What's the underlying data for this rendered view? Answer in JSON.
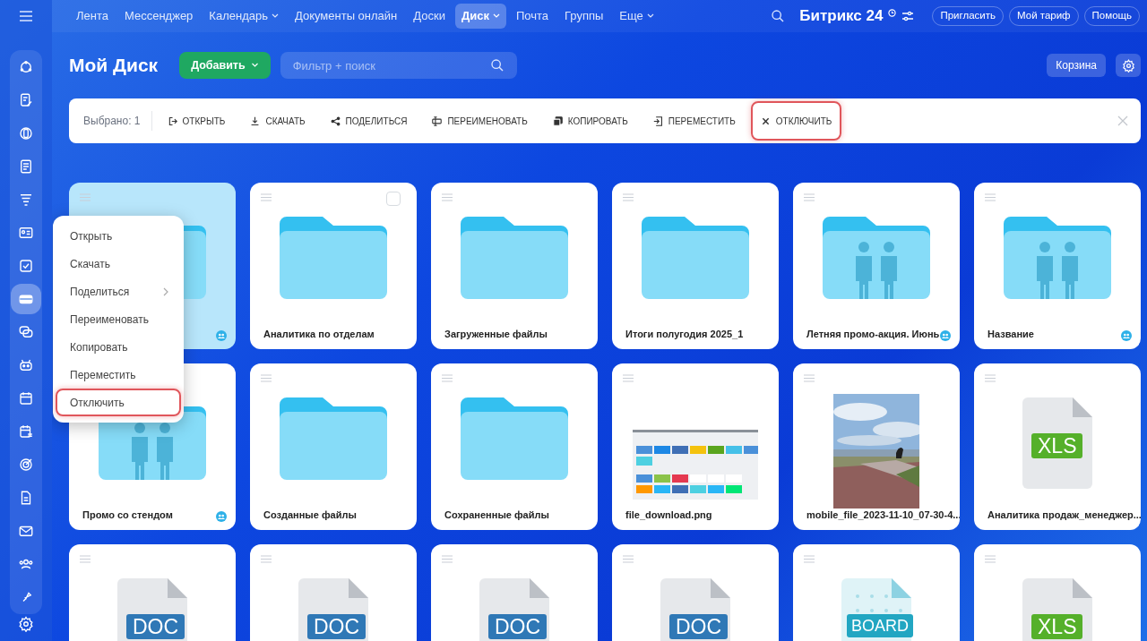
{
  "topbar": {
    "nav": [
      {
        "label": "Лента",
        "selected": false,
        "dropdown": false
      },
      {
        "label": "Мессенджер",
        "selected": false,
        "dropdown": false
      },
      {
        "label": "Календарь",
        "selected": false,
        "dropdown": true
      },
      {
        "label": "Документы онлайн",
        "selected": false,
        "dropdown": false
      },
      {
        "label": "Доски",
        "selected": false,
        "dropdown": false
      },
      {
        "label": "Диск",
        "selected": true,
        "dropdown": true
      },
      {
        "label": "Почта",
        "selected": false,
        "dropdown": false
      },
      {
        "label": "Группы",
        "selected": false,
        "dropdown": false
      },
      {
        "label": "Еще",
        "selected": false,
        "dropdown": true
      }
    ],
    "logo": "Битрикс 24",
    "buttons": [
      "Пригласить",
      "Мой тариф",
      "Помощь"
    ]
  },
  "sidebar": {
    "items": [
      {
        "kind": "recycle",
        "selected": false
      },
      {
        "kind": "edit",
        "selected": false
      },
      {
        "kind": "crm",
        "selected": false
      },
      {
        "kind": "document",
        "selected": false
      },
      {
        "kind": "funnel",
        "selected": false
      },
      {
        "kind": "card",
        "selected": false
      },
      {
        "kind": "tasks",
        "selected": false
      },
      {
        "kind": "drive",
        "selected": true
      },
      {
        "kind": "chat",
        "selected": false
      },
      {
        "kind": "robot",
        "selected": false
      },
      {
        "kind": "calendar",
        "selected": false
      },
      {
        "kind": "schedule",
        "selected": false
      },
      {
        "kind": "target",
        "selected": false
      },
      {
        "kind": "file",
        "selected": false
      },
      {
        "kind": "mail",
        "selected": false
      },
      {
        "kind": "people",
        "selected": false
      },
      {
        "kind": "pin",
        "selected": false
      }
    ]
  },
  "header": {
    "title": "Мой Диск",
    "add_button": "Добавить",
    "search": {
      "placeholder": "Фильтр + поиск"
    },
    "trash_button": "Корзина"
  },
  "action_bar": {
    "selected_count": "Выбрано: 1",
    "actions": [
      {
        "kind": "open",
        "label": "ОТКРЫТЬ",
        "highlighted": false
      },
      {
        "kind": "download",
        "label": "СКАЧАТЬ",
        "highlighted": false
      },
      {
        "kind": "share",
        "label": "ПОДЕЛИТЬСЯ",
        "highlighted": false
      },
      {
        "kind": "rename",
        "label": "ПЕРЕИМЕНОВАТЬ",
        "highlighted": false
      },
      {
        "kind": "copy",
        "label": "КОПИРОВАТЬ",
        "highlighted": false
      },
      {
        "kind": "move",
        "label": "ПЕРЕМЕСТИТЬ",
        "highlighted": false
      },
      {
        "kind": "disconnect",
        "label": "ОТКЛЮЧИТЬ",
        "highlighted": true
      }
    ]
  },
  "files": [
    {
      "kind": "folder",
      "selected": true,
      "shared": true,
      "hovered": false
    },
    {
      "kind": "folder",
      "name": "Аналитика по отделам",
      "selected": false,
      "shared": false,
      "hovered": true
    },
    {
      "kind": "folder",
      "name": "Загруженные файлы",
      "selected": false,
      "shared": false,
      "hovered": false
    },
    {
      "kind": "folder",
      "name": "Итоги полугодия 2025_1",
      "selected": false,
      "shared": false,
      "hovered": false
    },
    {
      "kind": "shared_folder",
      "name": "Летняя промо-акция. Июнь",
      "selected": false,
      "shared": true,
      "hovered": false
    },
    {
      "kind": "shared_folder",
      "name": "Название",
      "selected": false,
      "shared": true,
      "hovered": false
    },
    {
      "kind": "shared_folder",
      "name": "Промо со стендом",
      "selected": false,
      "shared": true,
      "hovered": false
    },
    {
      "kind": "folder",
      "name": "Созданные файлы",
      "selected": false,
      "shared": false,
      "hovered": false
    },
    {
      "kind": "folder",
      "name": "Сохраненные файлы",
      "selected": false,
      "shared": false,
      "hovered": false
    },
    {
      "kind": "screenshot",
      "name": "file_download.png",
      "selected": false,
      "shared": false,
      "hovered": false
    },
    {
      "name": "mobile_file_2023-11-10_07-30-4...",
      "selected": false,
      "shared": false,
      "hovered": false
    },
    {
      "kind": "xls",
      "badge": "XLS",
      "name": "Аналитика продаж_менеджер...",
      "selected": false,
      "shared": false,
      "hovered": false
    },
    {
      "kind": "doc",
      "badge": "DOC",
      "selected": false,
      "shared": false,
      "hovered": false
    },
    {
      "kind": "doc",
      "badge": "DOC",
      "selected": false,
      "shared": false,
      "hovered": false
    },
    {
      "kind": "doc",
      "badge": "DOC",
      "selected": false,
      "shared": false,
      "hovered": false
    },
    {
      "kind": "doc",
      "badge": "DOC",
      "selected": false,
      "shared": false,
      "hovered": false
    },
    {
      "kind": "board",
      "badge": "BOARD",
      "selected": false,
      "shared": false,
      "hovered": false
    },
    {
      "kind": "xls",
      "badge": "XLS",
      "selected": false,
      "shared": false,
      "hovered": false
    }
  ],
  "context_menu": {
    "items": [
      {
        "label": "Открыть",
        "submenu": false,
        "highlighted": false
      },
      {
        "label": "Скачать",
        "submenu": false,
        "highlighted": false
      },
      {
        "label": "Поделиться",
        "submenu": true,
        "highlighted": false
      },
      {
        "label": "Переименовать",
        "submenu": false,
        "highlighted": false
      },
      {
        "label": "Копировать",
        "submenu": false,
        "highlighted": false
      },
      {
        "label": "Переместить",
        "submenu": false,
        "highlighted": false
      },
      {
        "label": "Отключить",
        "submenu": false,
        "highlighted": true
      }
    ]
  }
}
